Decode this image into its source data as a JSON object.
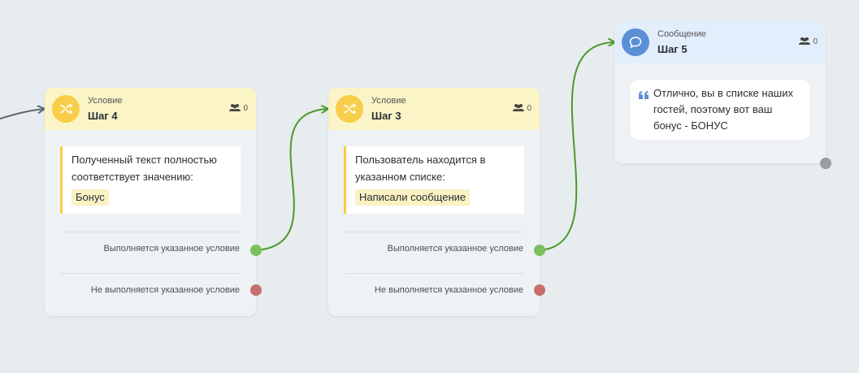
{
  "nodes": {
    "step4": {
      "type": "Условие",
      "title": "Шаг 4",
      "users_count": "0",
      "condition_text": "Полученный текст полностью соответствует значению:",
      "tag": "Бонус",
      "out_yes": "Выполняется указанное условие",
      "out_no": "Не выполняется указанное условие"
    },
    "step3": {
      "type": "Условие",
      "title": "Шаг 3",
      "users_count": "0",
      "condition_text": "Пользователь находится в указанном списке:",
      "tag": "Написали сообщение",
      "out_yes": "Выполняется указанное условие",
      "out_no": "Не выполняется указанное условие"
    },
    "step5": {
      "type": "Сообщение",
      "title": "Шаг 5",
      "users_count": "0",
      "message": "Отлично, вы в списке наших гостей, поэтому вот ваш бонус - БОНУС"
    }
  },
  "colors": {
    "condition_header": "#faf4c6",
    "condition_icon": "#f7cd4a",
    "message_header": "#e3eefc",
    "message_icon": "#5b8fd6",
    "link_active": "#4a9a2b",
    "link_incoming": "#5d6770",
    "port_yes": "#7cbf5d",
    "port_no": "#c86f6b",
    "port_out": "#9a9c9e"
  },
  "icons": {
    "condition": "shuffle-icon",
    "message": "chat-bubble-icon",
    "users": "users-icon",
    "quote": "quote-icon"
  }
}
